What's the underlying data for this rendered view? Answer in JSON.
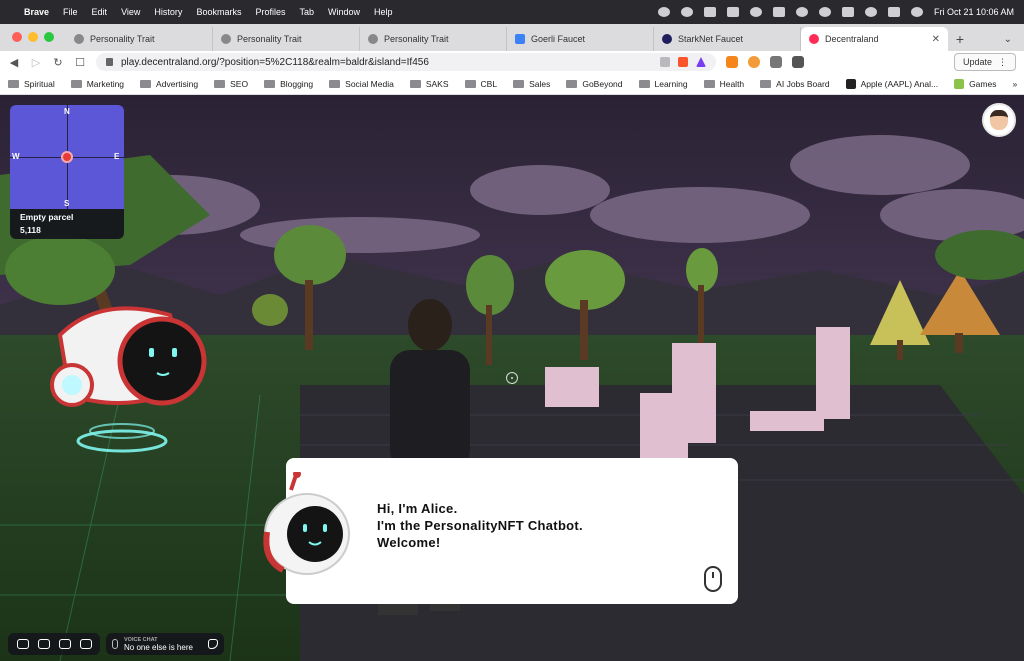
{
  "menubar": {
    "app": "Brave",
    "items": [
      "File",
      "Edit",
      "View",
      "History",
      "Bookmarks",
      "Profiles",
      "Tab",
      "Window",
      "Help"
    ],
    "datetime": "Fri Oct 21  10:06 AM"
  },
  "tabs": [
    {
      "label": "Personality Trait",
      "favicon_color": "#7a7a7f"
    },
    {
      "label": "Personality Trait",
      "favicon_color": "#7a7a7f"
    },
    {
      "label": "Personality Trait",
      "favicon_color": "#7a7a7f"
    },
    {
      "label": "Goerli Faucet",
      "favicon_color": "#3b82f6"
    },
    {
      "label": "StarkNet Faucet",
      "favicon_color": "#1f1f5c"
    },
    {
      "label": "Decentraland",
      "favicon_color": "#ff2d55",
      "active": true
    }
  ],
  "toolbar": {
    "url": "play.decentraland.org/?position=5%2C118&realm=baldr&island=If456",
    "update_label": "Update",
    "brave_badge": "8"
  },
  "bookmarks": [
    {
      "label": "Spiritual"
    },
    {
      "label": "Marketing"
    },
    {
      "label": "Advertising"
    },
    {
      "label": "SEO"
    },
    {
      "label": "Blogging"
    },
    {
      "label": "Social Media"
    },
    {
      "label": "SAKS"
    },
    {
      "label": "CBL"
    },
    {
      "label": "Sales"
    },
    {
      "label": "GoBeyond"
    },
    {
      "label": "Learning"
    },
    {
      "label": "Health"
    },
    {
      "label": "AI Jobs Board"
    },
    {
      "label": "Apple (AAPL) Anal...",
      "icon_color": "#222222"
    },
    {
      "label": "Games",
      "icon_color": "#8bc34a"
    }
  ],
  "bookmarks_more": "»",
  "minimap": {
    "north": "N",
    "south": "S",
    "east": "E",
    "west": "W",
    "parcel_name": "Empty parcel",
    "coords": "5,118"
  },
  "dialog": {
    "line1": "Hi, I'm Alice.",
    "line2": "I'm the PersonalityNFT Chatbot.",
    "line3": "Welcome!"
  },
  "voice_chat": {
    "title": "VOICE CHAT",
    "status": "No one else is here"
  },
  "colors": {
    "minimap_bg": "#5c57d6",
    "sky_top": "#2b2238",
    "ground": "#1f3a1f",
    "robot_red": "#d63a3a",
    "robot_glow": "#7ff6f0"
  }
}
